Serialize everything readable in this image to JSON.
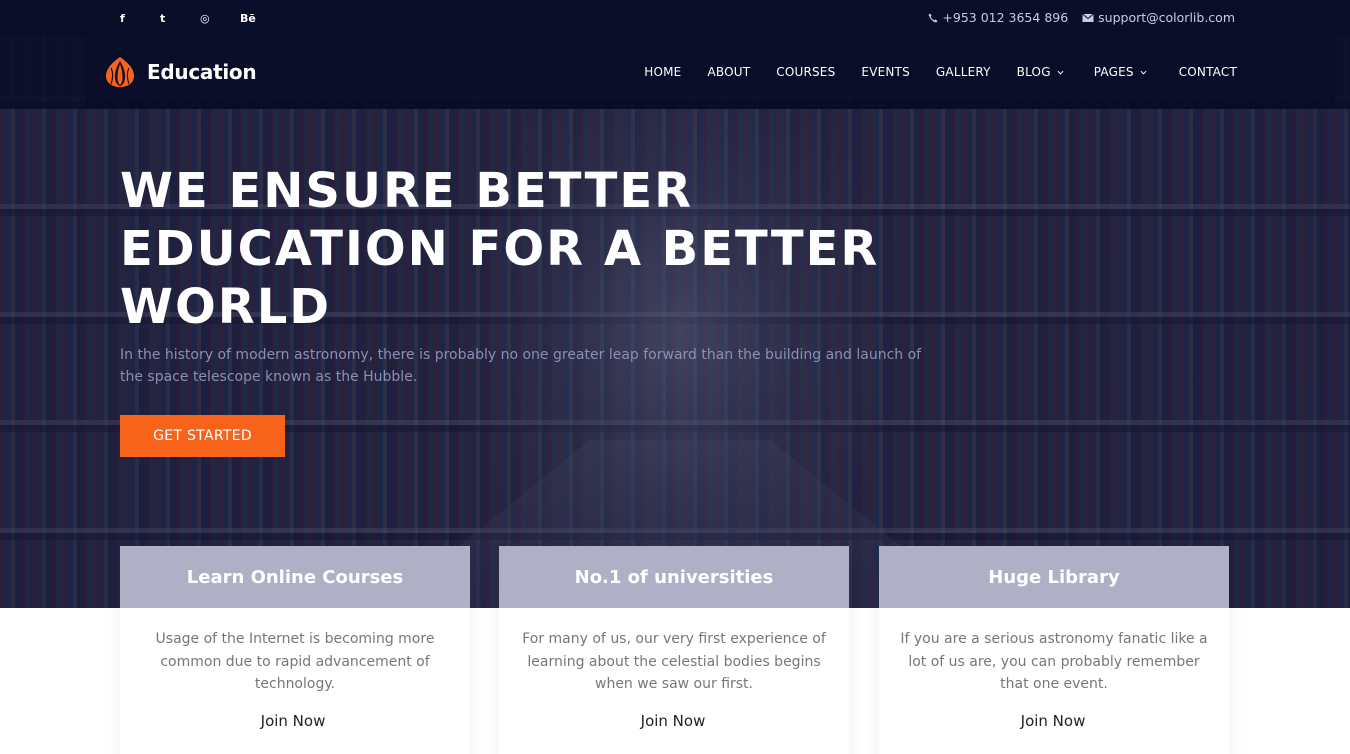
{
  "topbar": {
    "social": [
      {
        "icon": "facebook-icon",
        "glyph": "f"
      },
      {
        "icon": "twitter-icon",
        "glyph": "t"
      },
      {
        "icon": "dribbble-icon",
        "glyph": "◎"
      },
      {
        "icon": "behance-icon",
        "glyph": "Bē"
      }
    ],
    "phone": "+953 012 3654 896",
    "email": "support@colorlib.com"
  },
  "header": {
    "logo_text": "Education",
    "nav": [
      {
        "label": "HOME",
        "dropdown": false
      },
      {
        "label": "ABOUT",
        "dropdown": false
      },
      {
        "label": "COURSES",
        "dropdown": false
      },
      {
        "label": "EVENTS",
        "dropdown": false
      },
      {
        "label": "GALLERY",
        "dropdown": false
      },
      {
        "label": "BLOG",
        "dropdown": true
      },
      {
        "label": "PAGES",
        "dropdown": true
      },
      {
        "label": "CONTACT",
        "dropdown": false
      }
    ]
  },
  "hero": {
    "title_line1": "WE ENSURE BETTER",
    "title_line2": "EDUCATION FOR A BETTER",
    "title_line3": "WORLD",
    "description": "In the history of modern astronomy, there is probably no one greater leap forward than the building and launch of the space telescope known as the Hubble.",
    "cta_label": "GET STARTED"
  },
  "features": [
    {
      "title": "Learn Online Courses",
      "text": "Usage of the Internet is becoming more common due to rapid advancement of technology.",
      "link": "Join Now"
    },
    {
      "title": "No.1 of universities",
      "text": "For many of us, our very first experience of learning about the celestial bodies begins when we saw our first.",
      "link": "Join Now"
    },
    {
      "title": "Huge Library",
      "text": "If you are a serious astronomy fanatic like a lot of us are, you can probably remember that one event.",
      "link": "Join Now"
    }
  ],
  "colors": {
    "accent": "#f7631b",
    "navy": "#080c26"
  }
}
